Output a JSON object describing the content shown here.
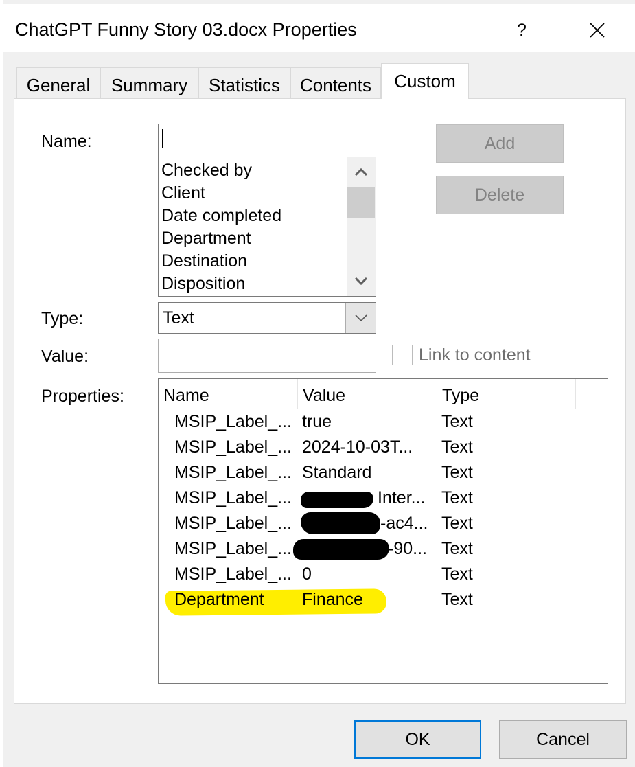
{
  "window": {
    "title": "ChatGPT Funny Story 03.docx Properties",
    "help_label": "?"
  },
  "tabs": [
    {
      "label": "General"
    },
    {
      "label": "Summary"
    },
    {
      "label": "Statistics"
    },
    {
      "label": "Contents"
    },
    {
      "label": "Custom",
      "active": true
    }
  ],
  "form": {
    "name_label": "Name:",
    "name_value": "",
    "name_options": [
      "Checked by",
      "Client",
      "Date completed",
      "Department",
      "Destination",
      "Disposition"
    ],
    "type_label": "Type:",
    "type_value": "Text",
    "value_label": "Value:",
    "value_value": "",
    "link_label": "Link to content",
    "link_checked": false,
    "add_label": "Add",
    "delete_label": "Delete",
    "properties_label": "Properties:"
  },
  "properties": {
    "columns": [
      "Name",
      "Value",
      "Type"
    ],
    "rows": [
      {
        "name": "MSIP_Label_...",
        "value": "true",
        "type": "Text"
      },
      {
        "name": "MSIP_Label_...",
        "value": "2024-10-03T...",
        "type": "Text"
      },
      {
        "name": "MSIP_Label_...",
        "value": "Standard",
        "type": "Text"
      },
      {
        "name": "MSIP_Label_...",
        "value": "Inter...",
        "type": "Text"
      },
      {
        "name": "MSIP_Label_...",
        "value": "-ac4...",
        "type": "Text"
      },
      {
        "name": "MSIP_Label_...",
        "value": "-90...",
        "type": "Text"
      },
      {
        "name": "MSIP_Label_...",
        "value": "0",
        "type": "Text"
      },
      {
        "name": "Department",
        "value": "Finance",
        "type": "Text"
      }
    ]
  },
  "footer": {
    "ok_label": "OK",
    "cancel_label": "Cancel"
  },
  "colors": {
    "highlight": "#ffee00",
    "focus_border": "#0078d7",
    "disabled_button": "#cccccc"
  }
}
